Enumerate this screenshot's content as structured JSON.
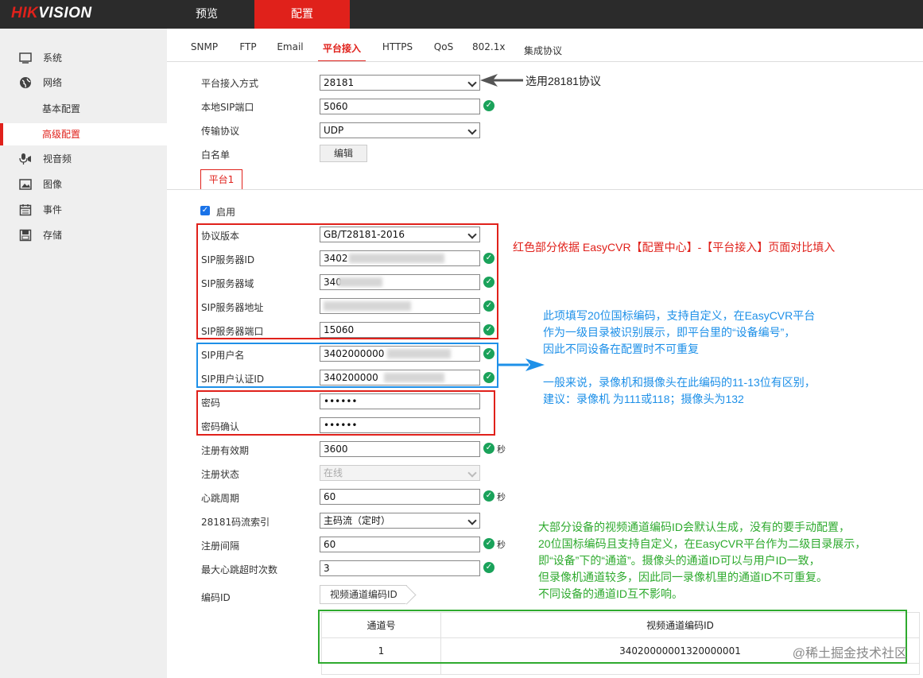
{
  "header": {
    "logo_red": "HIK",
    "logo_white": "VISION",
    "tabs": [
      "预览",
      "配置"
    ],
    "active_tab": "配置"
  },
  "sidebar": {
    "items": [
      {
        "label": "系统",
        "icon": "monitor-icon"
      },
      {
        "label": "网络",
        "icon": "globe-icon"
      },
      {
        "label": "基本配置",
        "icon": ""
      },
      {
        "label": "高级配置",
        "icon": ""
      },
      {
        "label": "视音频",
        "icon": "microphone-icon"
      },
      {
        "label": "图像",
        "icon": "image-icon"
      },
      {
        "label": "事件",
        "icon": "calendar-icon"
      },
      {
        "label": "存储",
        "icon": "disk-icon"
      }
    ],
    "active_item": "高级配置"
  },
  "subtabs": [
    "SNMP",
    "FTP",
    "Email",
    "平台接入",
    "HTTPS",
    "QoS",
    "802.1x",
    "集成协议"
  ],
  "active_subtab": "平台接入",
  "form": {
    "access_mode_label": "平台接入方式",
    "access_mode_value": "28181",
    "sip_port_label": "本地SIP端口",
    "sip_port_value": "5060",
    "transport_label": "传输协议",
    "transport_value": "UDP",
    "whitelist_label": "白名单",
    "whitelist_button": "编辑",
    "platform_tab": "平台1",
    "enable_label": "启用",
    "protocol_version_label": "协议版本",
    "protocol_version_value": "GB/T28181-2016",
    "sip_server_id_label": "SIP服务器ID",
    "sip_server_id_value": "3402",
    "sip_server_domain_label": "SIP服务器域",
    "sip_server_domain_value": "340",
    "sip_server_addr_label": "SIP服务器地址",
    "sip_server_addr_value": "",
    "sip_server_port_label": "SIP服务器端口",
    "sip_server_port_value": "15060",
    "sip_user_label": "SIP用户名",
    "sip_user_value": "3402000000",
    "sip_auth_label": "SIP用户认证ID",
    "sip_auth_value": "340200000",
    "password_label": "密码",
    "password_value": "••••••",
    "password_confirm_label": "密码确认",
    "password_confirm_value": "••••••",
    "reg_validity_label": "注册有效期",
    "reg_validity_value": "3600",
    "reg_status_label": "注册状态",
    "reg_status_value": "在线",
    "heartbeat_label": "心跳周期",
    "heartbeat_value": "60",
    "stream_index_label": "28181码流索引",
    "stream_index_value": "主码流（定时）",
    "reg_interval_label": "注册间隔",
    "reg_interval_value": "60",
    "max_timeout_label": "最大心跳超时次数",
    "max_timeout_value": "3",
    "unit_seconds": "秒",
    "encode_id_label": "编码ID",
    "encode_tab": "视频通道编码ID"
  },
  "table": {
    "headers": [
      "通道号",
      "视频通道编码ID"
    ],
    "rows": [
      [
        "1",
        "34020000001320000001"
      ]
    ]
  },
  "annotations": {
    "arrow_note": "选用28181协议",
    "red_note": "红色部分依据 EasyCVR【配置中心】-【平台接入】页面对比填入",
    "blue_note_1": "此项填写20位国标编码，支持自定义，在EasyCVR平台",
    "blue_note_2": "作为一级目录被识别展示，即平台里的“设备编号”，",
    "blue_note_3": "因此不同设备在配置时不可重复",
    "blue_note_4": "一般来说，录像机和摄像头在此编码的11-13位有区别，",
    "blue_note_5": "建议：录像机 为111或118；摄像头为132",
    "green_note_1": "大部分设备的视频通道编码ID会默认生成，没有的要手动配置，",
    "green_note_2": "20位国标编码且支持自定义，在EasyCVR平台作为二级目录展示，",
    "green_note_3": "即“设备”下的“通道”。摄像头的通道ID可以与用户ID一致，",
    "green_note_4": "但录像机通道较多，因此同一录像机里的通道ID不可重复。",
    "green_note_5": "不同设备的通道ID互不影响。",
    "watermark": "@稀土掘金技术社区"
  },
  "colors": {
    "brand": "#e0211b",
    "ok": "#1aa25a",
    "blue": "#1e90e8",
    "green": "#2eaa2e"
  }
}
